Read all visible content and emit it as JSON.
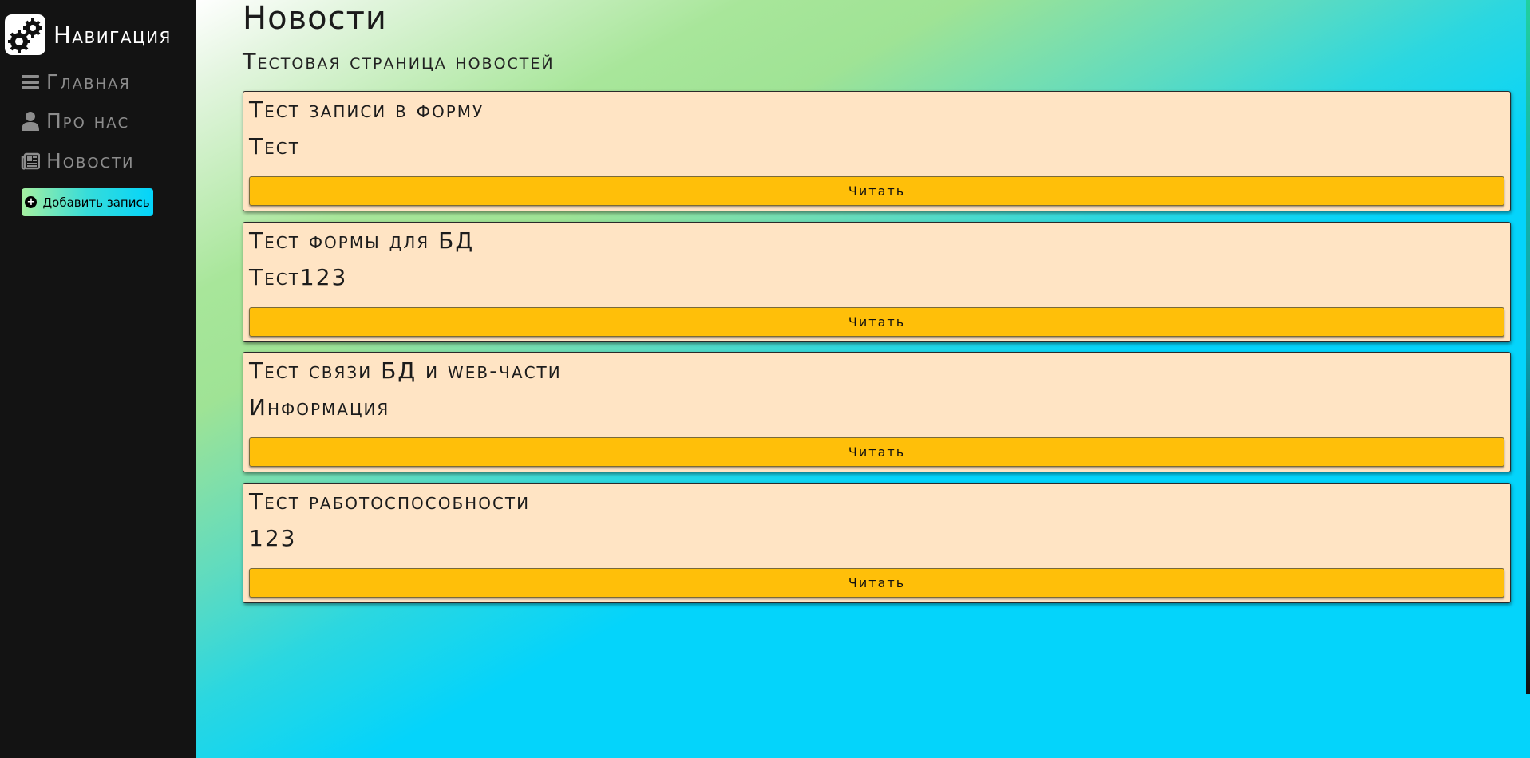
{
  "sidebar": {
    "brand_title": "Навигация",
    "brand_icon": "gears-icon",
    "items": [
      {
        "label": "Главная",
        "icon": "bars-icon"
      },
      {
        "label": "Про нас",
        "icon": "user-icon"
      },
      {
        "label": "Новости",
        "icon": "newspaper-icon"
      }
    ],
    "add_button_label": "Добавить запись",
    "add_button_icon": "plus-circle-icon"
  },
  "main": {
    "title": "Новости",
    "subtitle": "Тестовая страница новостей",
    "cards": [
      {
        "title": "Тест записи в форму",
        "text": "Тест",
        "button": "Читать"
      },
      {
        "title": "Тест формы для БД",
        "text": "Тест123",
        "button": "Читать"
      },
      {
        "title": "Тест связи БД и web-части",
        "text": "Информация",
        "button": "Читать"
      },
      {
        "title": "Тест работоспособности",
        "text": "123",
        "button": "Читать"
      }
    ]
  },
  "colors": {
    "sidebar_bg": "#131313",
    "card_bg": "#ffe4c4",
    "button_bg": "#ffbf09",
    "accent_cyan": "#04d4fb",
    "accent_green": "#9fe395"
  }
}
